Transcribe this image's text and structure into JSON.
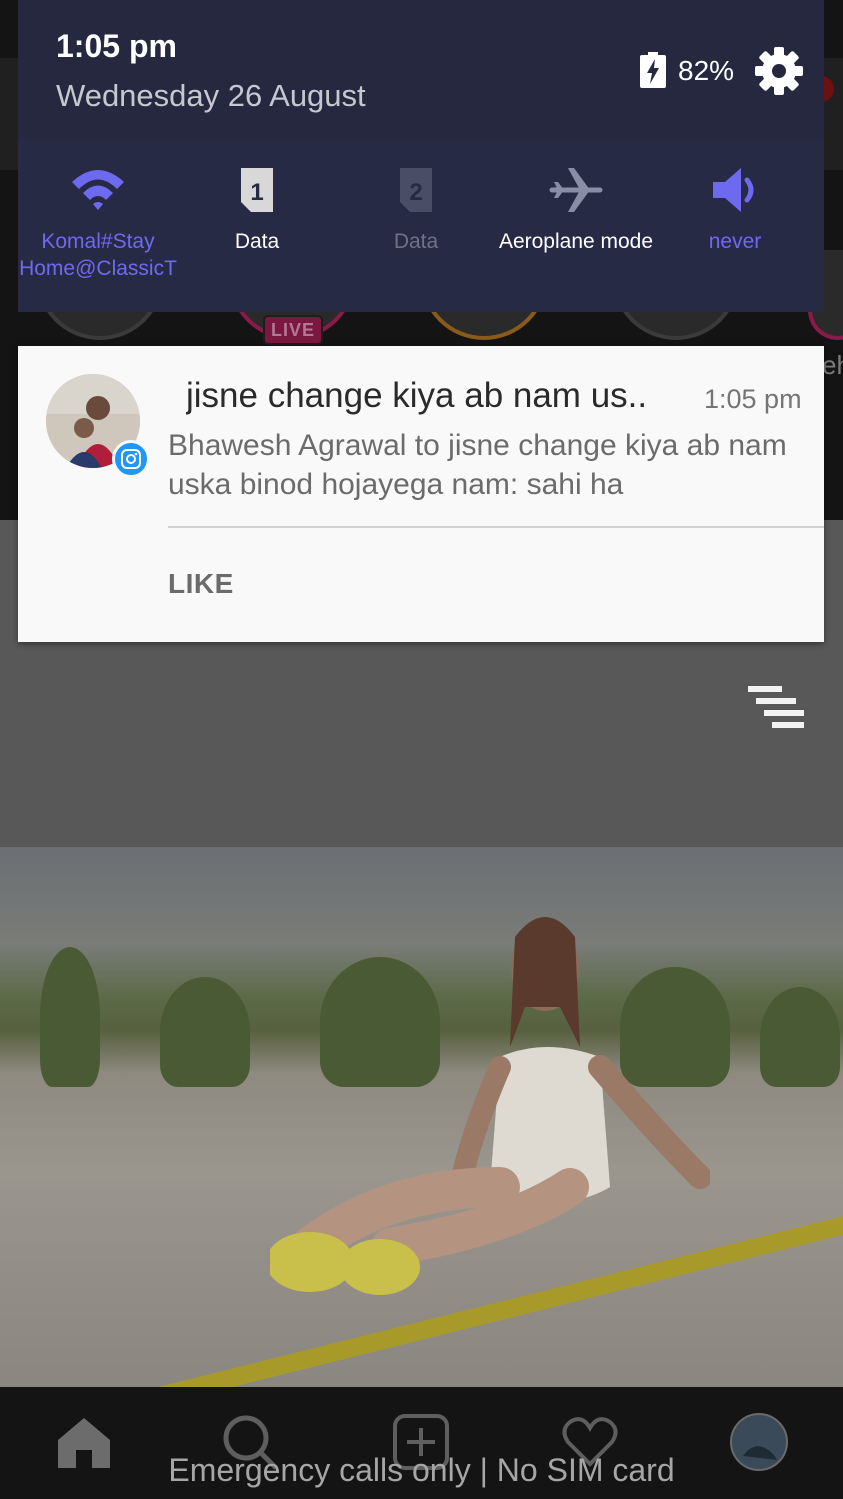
{
  "status_shade": {
    "time": "1:05 pm",
    "date": "Wednesday 26 August",
    "battery_percent": "82%",
    "battery_icon": "battery-charging-icon",
    "settings_icon": "gear-icon"
  },
  "quick_settings": [
    {
      "id": "wifi",
      "label": "Komal#Stay\nHome@ClassicT",
      "icon": "wifi-icon",
      "color": "#6e6af0",
      "active": true
    },
    {
      "id": "data1",
      "label": "Data",
      "icon": "sim-1-icon",
      "color": "#ffffff",
      "active": true
    },
    {
      "id": "data2",
      "label": "Data",
      "icon": "sim-2-icon",
      "color": "#6f7286",
      "active": false
    },
    {
      "id": "aeroplane",
      "label": "Aeroplane mode",
      "icon": "airplane-icon",
      "color": "#ffffff",
      "active": false
    },
    {
      "id": "sound",
      "label": "never",
      "icon": "speaker-icon",
      "color": "#6e6af0",
      "active": true
    }
  ],
  "notification": {
    "app_icon": "instagram-icon",
    "title": "jisne change kiya ab nam us..",
    "time": "1:05 pm",
    "body": "Bhawesh Agrawal to jisne change kiya ab nam uska binod hojayega nam: sahi ha",
    "action_label": "LIKE"
  },
  "background_app": {
    "live_badge": "LIVE",
    "partial_text": "eh",
    "menu_icon": "menu-lines-icon",
    "nav_icons": [
      "home-icon",
      "search-icon",
      "add-post-icon",
      "heart-icon",
      "profile-avatar"
    ]
  },
  "lockscreen_footer": "Emergency calls only | No SIM card",
  "colors": {
    "accent": "#6e6af0",
    "shade_bg": "#272a45",
    "card_bg": "#f9f9f9",
    "instagram_badge": "#2196f3"
  }
}
